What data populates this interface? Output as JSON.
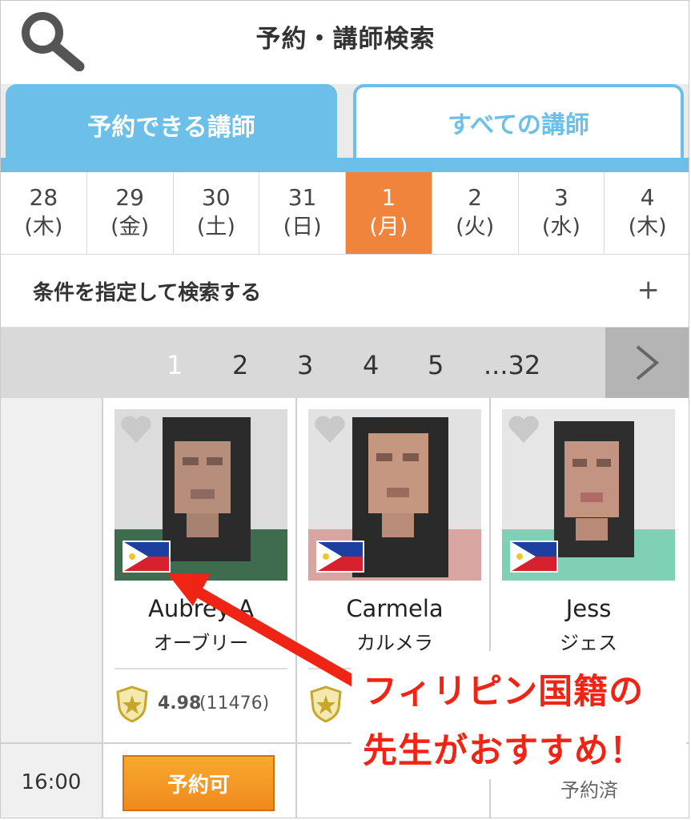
{
  "header": {
    "title": "予約・講師検索",
    "search_icon": "search-icon"
  },
  "tabs": [
    {
      "label": "予約できる講師",
      "active": true
    },
    {
      "label": "すべての講師",
      "active": false
    }
  ],
  "dates": [
    {
      "num": "28",
      "dow": "(木)"
    },
    {
      "num": "29",
      "dow": "(金)"
    },
    {
      "num": "30",
      "dow": "(土)"
    },
    {
      "num": "31",
      "dow": "(日)"
    },
    {
      "num": "1",
      "dow": "(月)",
      "selected": true
    },
    {
      "num": "2",
      "dow": "(火)"
    },
    {
      "num": "3",
      "dow": "(水)"
    },
    {
      "num": "4",
      "dow": "(木)"
    }
  ],
  "filter": {
    "label": "条件を指定して検索する",
    "toggle": "+"
  },
  "pagination": {
    "pages": [
      "1",
      "2",
      "3",
      "4",
      "5",
      "...32"
    ],
    "current": "1"
  },
  "teachers": [
    {
      "name_en": "Aubrey A",
      "name_ja": "オーブリー",
      "rating": "4.98",
      "review_count": "(11476)",
      "country": "Philippines"
    },
    {
      "name_en": "Carmela",
      "name_ja": "カルメラ",
      "country": "Philippines"
    },
    {
      "name_en": "Jess",
      "name_ja": "ジェス",
      "country": "Philippines"
    }
  ],
  "slot": {
    "time": "16:00",
    "available_label": "予約可",
    "booked_label": "予約済"
  },
  "annotation": {
    "line1": "フィリピン国籍の",
    "line2": "先生がおすすめ！"
  },
  "colors": {
    "accent_blue": "#6cbfe8",
    "selected_orange": "#f0843c",
    "annotation_red": "#f02414",
    "button_orange": "#f7a92e"
  }
}
